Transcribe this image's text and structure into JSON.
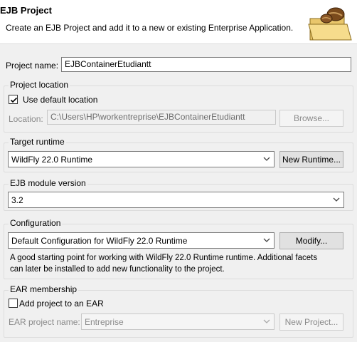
{
  "header": {
    "title": "EJB Project",
    "description": "Create an EJB Project and add it to a new or existing Enterprise Application."
  },
  "project_name": {
    "label": "Project name:",
    "value": "EJBContainerEtudiantt"
  },
  "project_location": {
    "group_title": "Project location",
    "use_default_label": "Use default location",
    "use_default_checked": true,
    "location_label": "Location:",
    "location_value": "C:\\Users\\HP\\workentreprise\\EJBContainerEtudiantt",
    "browse_label": "Browse..."
  },
  "target_runtime": {
    "group_title": "Target runtime",
    "selected": "WildFly 22.0 Runtime",
    "new_runtime_label": "New Runtime..."
  },
  "ejb_module_version": {
    "group_title": "EJB module version",
    "selected": "3.2"
  },
  "configuration": {
    "group_title": "Configuration",
    "selected": "Default Configuration for WildFly 22.0 Runtime",
    "modify_label": "Modify...",
    "help_line1": "A good starting point for working with WildFly 22.0 Runtime runtime. Additional facets",
    "help_line2": "can later be installed to add new functionality to the project."
  },
  "ear_membership": {
    "group_title": "EAR membership",
    "add_to_ear_label": "Add project to an EAR",
    "add_to_ear_checked": false,
    "ear_name_label": "EAR project name:",
    "ear_name_value": "Entreprise",
    "new_project_label": "New Project..."
  }
}
